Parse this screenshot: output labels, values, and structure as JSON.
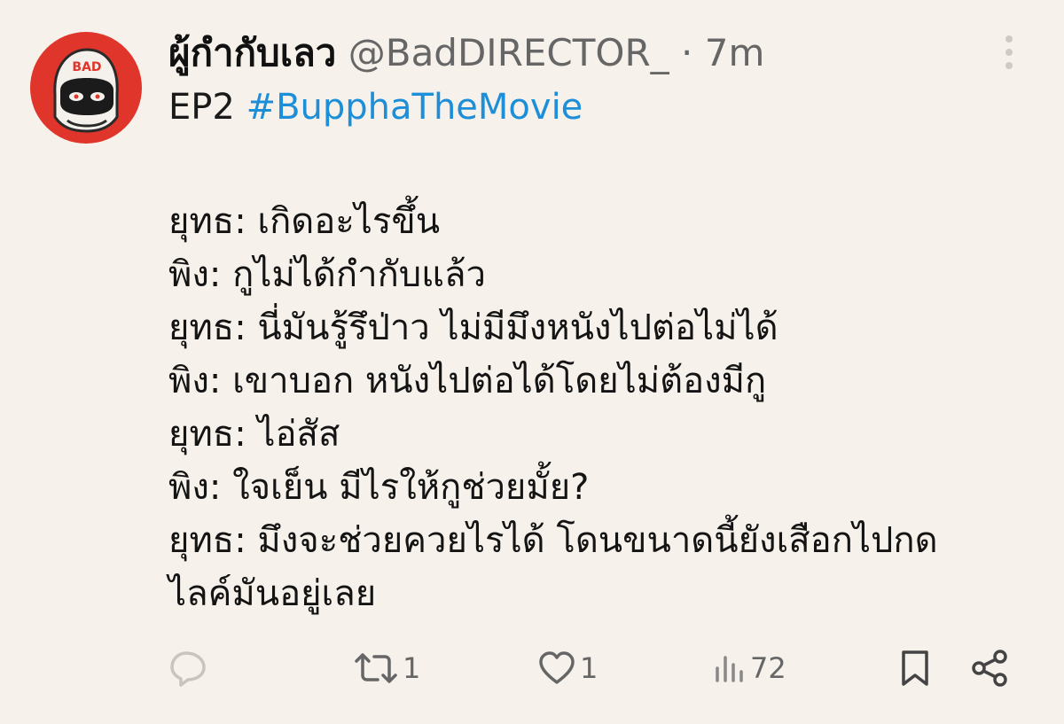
{
  "tweet": {
    "author_name": "ผู้กำกับเลว",
    "author_handle": "@BadDIRECTOR_",
    "separator": "·",
    "time": "7m",
    "subtitle_prefix": "EP2",
    "hashtag": "#BupphaTheMovie",
    "avatar_text": "BAD",
    "body_lines": [
      "ยุทธ: เกิดอะไรขึ้น",
      "พิง: กูไม่ได้กำกับแล้ว",
      "ยุทธ: นี่มันรู้รึป่าว ไม่มีมึงหนังไปต่อไม่ได้",
      "พิง: เขาบอก หนังไปต่อได้โดยไม่ต้องมีกู",
      "ยุทธ: ไอ่สัส",
      "พิง: ใจเย็น มีไรให้กูช่วยมั้ย?",
      "ยุทธ: มึงจะช่วยควยไรได้ โดนขนาดนี้ยังเสือกไปกด",
      "ไลค์มันอยู่เลย"
    ]
  },
  "actions": {
    "reply_icon": "reply-icon",
    "retweet_icon": "retweet-icon",
    "retweet_count": "1",
    "like_icon": "heart-icon",
    "like_count": "1",
    "views_icon": "views-icon",
    "views_count": "72",
    "bookmark_icon": "bookmark-icon",
    "share_icon": "share-icon"
  },
  "colors": {
    "background": "#f6f1ea",
    "hashtag": "#1d8ed8",
    "muted": "#666666",
    "avatar_bg": "#e0352a"
  }
}
